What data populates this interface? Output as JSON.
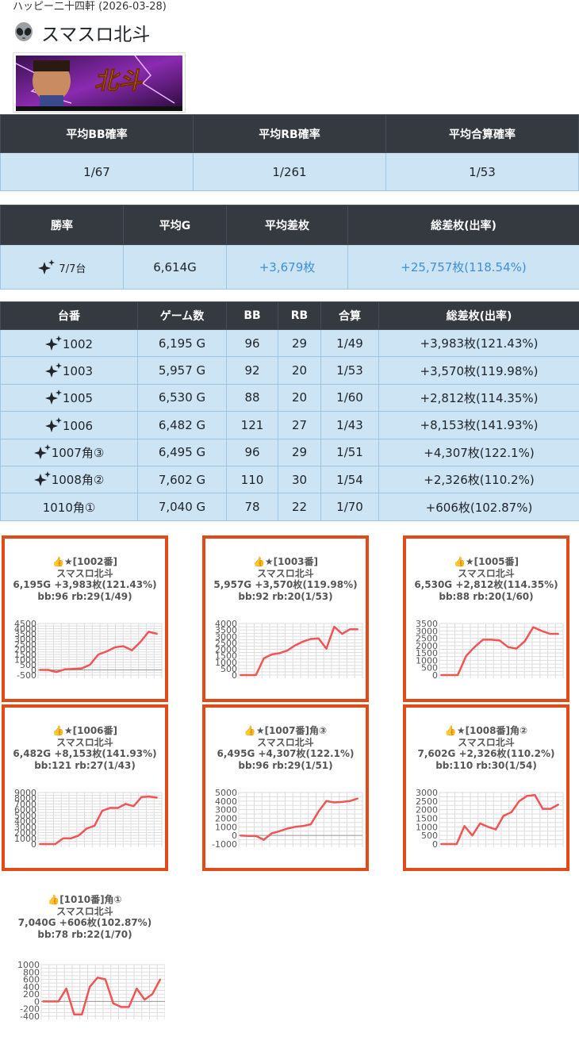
{
  "breadcrumb": "ハッピー二十四軒 (2026-03-28)",
  "page_title": "スマスロ北斗",
  "title_icon": "alien-icon",
  "banner_icon": "game-banner-icon",
  "summary": {
    "headers": [
      "平均BB確率",
      "平均RB確率",
      "平均合算確率"
    ],
    "values": [
      "1/67",
      "1/261",
      "1/53"
    ]
  },
  "stats": {
    "headers": [
      "勝率",
      "平均G",
      "平均差枚",
      "総差枚(出率)"
    ],
    "win_rate": "7/7台",
    "avg_games": "6,614G",
    "avg_diff": "+3,679枚",
    "total_diff": "+25,757枚(118.54%)"
  },
  "machines_table": {
    "headers": [
      "台番",
      "ゲーム数",
      "BB",
      "RB",
      "合算",
      "総差枚(出率)"
    ],
    "rows": [
      {
        "id": "1002",
        "games": "6,195 G",
        "bb": "96",
        "rb": "29",
        "total": "1/49",
        "diff": "+3,983枚(121.43%)",
        "spark": true
      },
      {
        "id": "1003",
        "games": "5,957 G",
        "bb": "92",
        "rb": "20",
        "total": "1/53",
        "diff": "+3,570枚(119.98%)",
        "spark": true
      },
      {
        "id": "1005",
        "games": "6,530 G",
        "bb": "88",
        "rb": "20",
        "total": "1/60",
        "diff": "+2,812枚(114.35%)",
        "spark": true
      },
      {
        "id": "1006",
        "games": "6,482 G",
        "bb": "121",
        "rb": "27",
        "total": "1/43",
        "diff": "+8,153枚(141.93%)",
        "spark": true
      },
      {
        "id": "1007角③",
        "games": "6,495 G",
        "bb": "96",
        "rb": "29",
        "total": "1/51",
        "diff": "+4,307枚(122.1%)",
        "spark": true
      },
      {
        "id": "1008角②",
        "games": "7,602 G",
        "bb": "110",
        "rb": "30",
        "total": "1/54",
        "diff": "+2,326枚(110.2%)",
        "spark": true
      },
      {
        "id": "1010角①",
        "games": "7,040 G",
        "bb": "78",
        "rb": "22",
        "total": "1/70",
        "diff": "+606枚(102.87%)",
        "spark": false
      }
    ]
  },
  "chart_data": [
    {
      "type": "line",
      "heading": "👍★[1002番]",
      "machine": "スマスロ北斗",
      "summary": "6,195G +3,983枚(121.43%)",
      "ratios": "bb:96 rb:29(1/49)",
      "yticks": [
        4500,
        4000,
        3500,
        3000,
        2500,
        2000,
        1500,
        1000,
        500,
        0,
        -500
      ],
      "ylim": [
        -500,
        4500
      ],
      "values": [
        0,
        0,
        -200,
        50,
        100,
        150,
        500,
        1500,
        1800,
        2200,
        2300,
        1900,
        2700,
        3700,
        3500
      ],
      "line_color": "#f05555",
      "highlight": true
    },
    {
      "type": "line",
      "heading": "👍★[1003番]",
      "machine": "スマスロ北斗",
      "summary": "5,957G +3,570枚(119.98%)",
      "ratios": "bb:92 rb:20(1/53)",
      "yticks": [
        4000,
        3500,
        3000,
        2500,
        2000,
        1500,
        1000,
        500,
        0
      ],
      "ylim": [
        0,
        4000
      ],
      "values": [
        0,
        0,
        0,
        1300,
        1600,
        1700,
        1900,
        2300,
        2600,
        2800,
        2850,
        2050,
        3750,
        3200,
        3550,
        3550
      ],
      "line_color": "#f05555",
      "highlight": true
    },
    {
      "type": "line",
      "heading": "👍★[1005番]",
      "machine": "スマスロ北斗",
      "summary": "6,530G +2,812枚(114.35%)",
      "ratios": "bb:88 rb:20(1/60)",
      "yticks": [
        3500,
        3000,
        2500,
        2000,
        1500,
        1000,
        500,
        0
      ],
      "ylim": [
        0,
        3500
      ],
      "values": [
        0,
        0,
        0,
        1300,
        1900,
        2400,
        2400,
        2350,
        1900,
        1800,
        2300,
        3250,
        3000,
        2800,
        2800
      ],
      "line_color": "#f05555",
      "highlight": true
    },
    {
      "type": "line",
      "heading": "👍★[1006番]",
      "machine": "スマスロ北斗",
      "summary": "6,482G +8,153枚(141.93%)",
      "ratios": "bb:121 rb:27(1/43)",
      "yticks": [
        9000,
        8000,
        7000,
        6000,
        5000,
        4000,
        3000,
        2000,
        1000,
        0
      ],
      "ylim": [
        0,
        9000
      ],
      "values": [
        0,
        0,
        0,
        1000,
        1000,
        1500,
        2700,
        3200,
        5800,
        6300,
        6300,
        7000,
        6600,
        8200,
        8300,
        8100
      ],
      "line_color": "#f05555",
      "highlight": true
    },
    {
      "type": "line",
      "heading": "👍★[1007番]角③",
      "machine": "スマスロ北斗",
      "summary": "6,495G +4,307枚(122.1%)",
      "ratios": "bb:96 rb:29(1/51)",
      "yticks": [
        5000,
        4000,
        3000,
        2000,
        1000,
        0,
        -1000
      ],
      "ylim": [
        -1000,
        5000
      ],
      "values": [
        0,
        -50,
        -50,
        -500,
        250,
        500,
        800,
        1000,
        1100,
        1300,
        2800,
        4000,
        3850,
        3900,
        4000,
        4300
      ],
      "line_color": "#f05555",
      "highlight": true
    },
    {
      "type": "line",
      "heading": "👍★[1008番]角②",
      "machine": "スマスロ北斗",
      "summary": "7,602G +2,326枚(110.2%)",
      "ratios": "bb:110 rb:30(1/54)",
      "yticks": [
        3000,
        2500,
        2000,
        1500,
        1000,
        500,
        0
      ],
      "ylim": [
        0,
        3000
      ],
      "values": [
        0,
        0,
        0,
        1050,
        500,
        1200,
        1000,
        850,
        1650,
        1850,
        2500,
        2800,
        2850,
        2050,
        2050,
        2300
      ],
      "line_color": "#f05555",
      "highlight": true
    },
    {
      "type": "line",
      "heading": "👍[1010番]角①",
      "machine": "スマスロ北斗",
      "summary": "7,040G +606枚(102.87%)",
      "ratios": "bb:78 rb:22(1/70)",
      "yticks": [
        1000,
        800,
        600,
        400,
        200,
        0,
        -200,
        -400
      ],
      "ylim": [
        -400,
        1000
      ],
      "values": [
        0,
        0,
        0,
        350,
        -350,
        -350,
        400,
        650,
        600,
        -50,
        -150,
        -150,
        350,
        50,
        200,
        600
      ],
      "line_color": "#f05555",
      "highlight": false
    }
  ]
}
